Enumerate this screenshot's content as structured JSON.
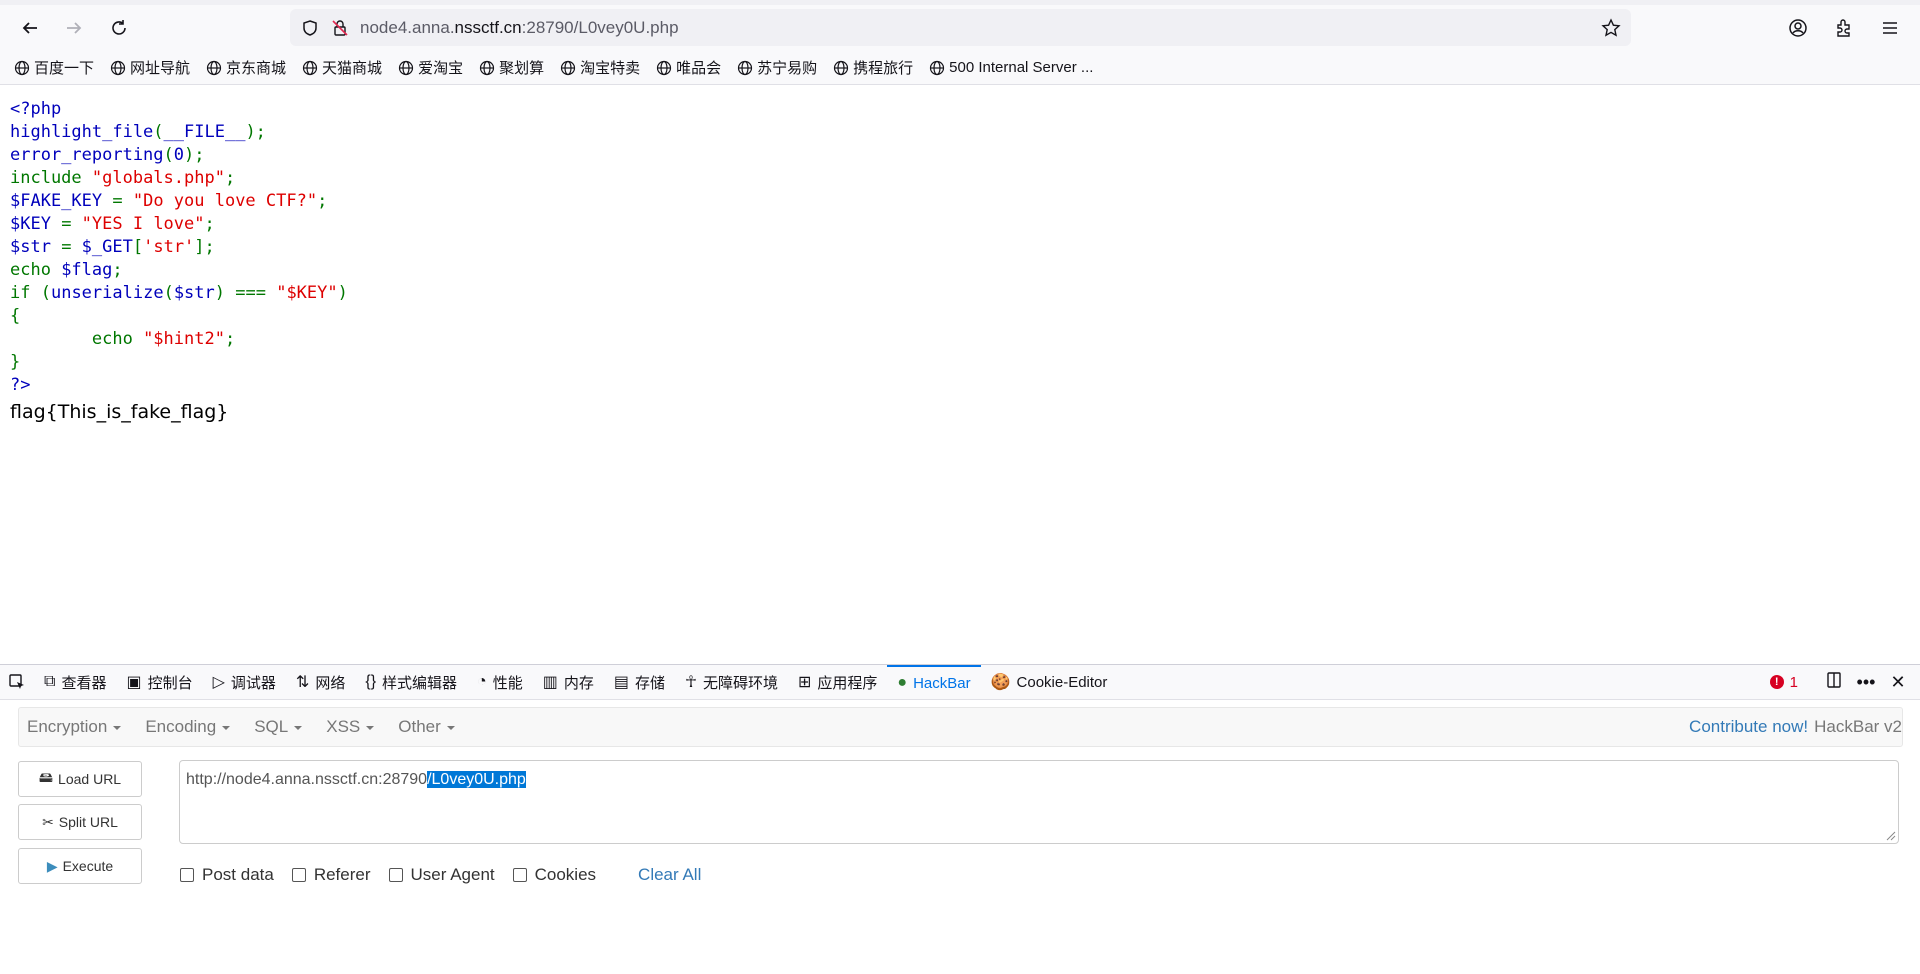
{
  "browser": {
    "url_prefix": "node4.anna.",
    "url_domain": "nssctf.cn",
    "url_suffix": ":28790/L0vey0U.php"
  },
  "bookmarks": [
    "百度一下",
    "网址导航",
    "京东商城",
    "天猫商城",
    "爱淘宝",
    "聚划算",
    "淘宝特卖",
    "唯品会",
    "苏宁易购",
    "携程旅行",
    "500 Internal Server ..."
  ],
  "page": {
    "code_lines": [
      [
        {
          "t": "<?php",
          "c": "def"
        }
      ],
      [
        {
          "t": "highlight_file",
          "c": "def"
        },
        {
          "t": "(",
          "c": "kw"
        },
        {
          "t": "__FILE__",
          "c": "def"
        },
        {
          "t": ");",
          "c": "kw"
        }
      ],
      [
        {
          "t": "error_reporting",
          "c": "def"
        },
        {
          "t": "(",
          "c": "kw"
        },
        {
          "t": "0",
          "c": "def"
        },
        {
          "t": ");",
          "c": "kw"
        }
      ],
      [
        {
          "t": "include ",
          "c": "kw"
        },
        {
          "t": "\"globals.php\"",
          "c": "str"
        },
        {
          "t": ";",
          "c": "kw"
        }
      ],
      [
        {
          "t": "$FAKE_KEY ",
          "c": "def"
        },
        {
          "t": "= ",
          "c": "kw"
        },
        {
          "t": "\"Do you love CTF?\"",
          "c": "str"
        },
        {
          "t": ";",
          "c": "kw"
        }
      ],
      [
        {
          "t": "$KEY ",
          "c": "def"
        },
        {
          "t": "= ",
          "c": "kw"
        },
        {
          "t": "\"YES I love\"",
          "c": "str"
        },
        {
          "t": ";",
          "c": "kw"
        }
      ],
      [
        {
          "t": "$str ",
          "c": "def"
        },
        {
          "t": "= ",
          "c": "kw"
        },
        {
          "t": "$_GET",
          "c": "def"
        },
        {
          "t": "[",
          "c": "kw"
        },
        {
          "t": "'str'",
          "c": "str"
        },
        {
          "t": "];",
          "c": "kw"
        }
      ],
      [
        {
          "t": "echo ",
          "c": "kw"
        },
        {
          "t": "$flag",
          "c": "def"
        },
        {
          "t": ";",
          "c": "kw"
        }
      ],
      [
        {
          "t": "if ",
          "c": "kw"
        },
        {
          "t": "(",
          "c": "kw"
        },
        {
          "t": "unserialize",
          "c": "def"
        },
        {
          "t": "(",
          "c": "kw"
        },
        {
          "t": "$str",
          "c": "def"
        },
        {
          "t": ") ",
          "c": "kw"
        },
        {
          "t": "=== ",
          "c": "kw"
        },
        {
          "t": "\"$KEY\"",
          "c": "str"
        },
        {
          "t": ")",
          "c": "kw"
        }
      ],
      [
        {
          "t": "{",
          "c": "kw"
        }
      ],
      [
        {
          "t": "        echo ",
          "c": "kw"
        },
        {
          "t": "\"$hint2\"",
          "c": "str"
        },
        {
          "t": ";",
          "c": "kw"
        }
      ],
      [
        {
          "t": "}",
          "c": "kw"
        }
      ],
      [
        {
          "t": "?>",
          "c": "def"
        }
      ]
    ],
    "flag_output": "flag{This_is_fake_flag}"
  },
  "devtools": {
    "tabs": [
      {
        "label": "查看器",
        "icon": "inspector-icon"
      },
      {
        "label": "控制台",
        "icon": "console-icon"
      },
      {
        "label": "调试器",
        "icon": "debugger-icon"
      },
      {
        "label": "网络",
        "icon": "network-icon"
      },
      {
        "label": "样式编辑器",
        "icon": "style-editor-icon"
      },
      {
        "label": "性能",
        "icon": "performance-icon"
      },
      {
        "label": "内存",
        "icon": "memory-icon"
      },
      {
        "label": "存储",
        "icon": "storage-icon"
      },
      {
        "label": "无障碍环境",
        "icon": "accessibility-icon"
      },
      {
        "label": "应用程序",
        "icon": "application-icon"
      },
      {
        "label": "HackBar",
        "icon": "hackbar-icon",
        "active": true
      },
      {
        "label": "Cookie-Editor",
        "icon": "cookie-icon"
      }
    ],
    "error_count": "1"
  },
  "hackbar": {
    "menus": [
      "Encryption",
      "Encoding",
      "SQL",
      "XSS",
      "Other"
    ],
    "contribute": "Contribute now!",
    "version": "HackBar v2",
    "buttons": {
      "load": "Load URL",
      "split": "Split URL",
      "execute": "Execute"
    },
    "url_plain": "http://node4.anna.nssctf.cn:28790",
    "url_selected": "/L0vey0U.php",
    "options": [
      "Post data",
      "Referer",
      "User Agent",
      "Cookies"
    ],
    "clear_all": "Clear All"
  }
}
